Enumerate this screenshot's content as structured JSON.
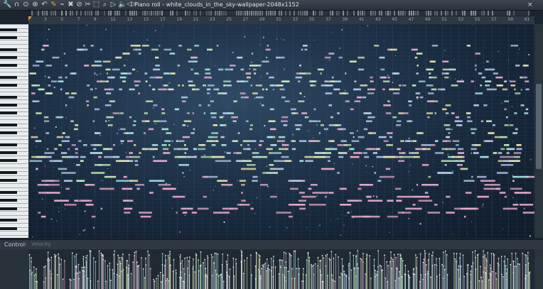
{
  "window": {
    "title": "Piano roll - white_clouds_in_the_sky-wallpaper-2048x1152",
    "title_arrow": "›",
    "close": "×"
  },
  "toolbar": {
    "icons": [
      "wrench-icon",
      "magnet-icon",
      "play-circle-icon",
      "target-icon",
      "undo-icon",
      "pencil-icon",
      "brush-icon",
      "delete-icon",
      "mute-icon",
      "slice-icon",
      "select-icon",
      "zoom-icon",
      "playback-icon",
      "volume-icon",
      "stamp-icon"
    ],
    "glyphs": [
      "🔧",
      "∩",
      "⊙",
      "⊕",
      "↶",
      "✎",
      "⌁",
      "✖",
      "⊘",
      "✂",
      "⬚",
      "⌕",
      "▷",
      "🔈",
      "♪"
    ],
    "speaker_arrow": "◁▷"
  },
  "ruler": {
    "bar_numbers": [
      3,
      5,
      7,
      9,
      11,
      13,
      15,
      17,
      19,
      21,
      23,
      25,
      27,
      29,
      31,
      33,
      35,
      37,
      39,
      41,
      43,
      45,
      47,
      49,
      51,
      53,
      55,
      57,
      59,
      61
    ]
  },
  "control": {
    "label": "Control",
    "arrow": "›",
    "sub": "Velocity"
  },
  "colors": {
    "note_pink": "#e9a9c9",
    "note_blue": "#b9c8ea",
    "note_green": "#c9ecb3",
    "note_cyan": "#a9e4e6",
    "note_yellow": "#ece6a9",
    "accent_marker": "#e39a2e"
  }
}
